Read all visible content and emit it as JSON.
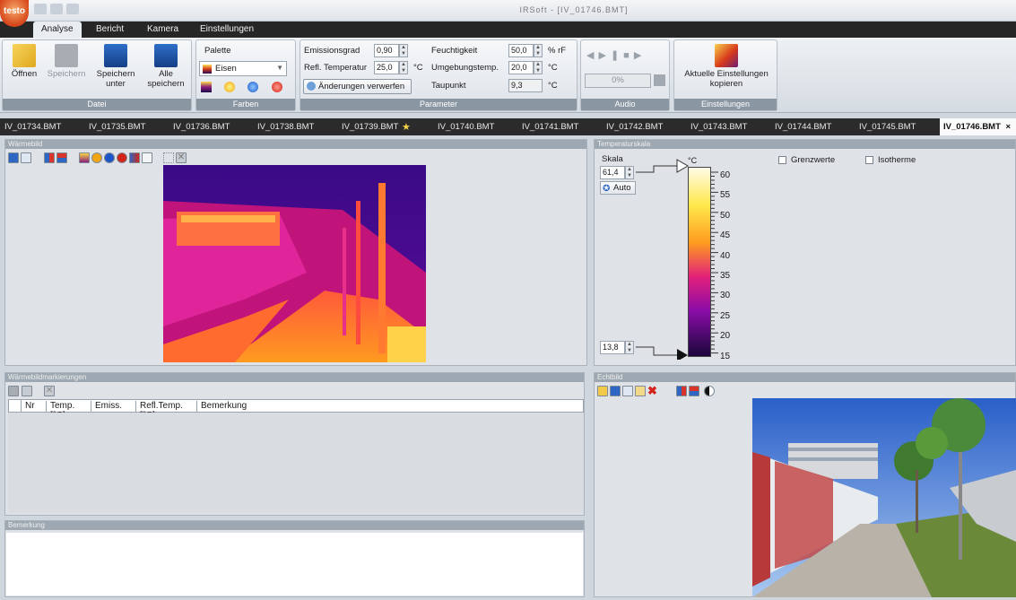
{
  "app": {
    "logo": "testo",
    "window_title": "IRSoft - [IV_01746.BMT]"
  },
  "menu_tabs": [
    "Analyse",
    "Bericht",
    "Kamera",
    "Einstellungen"
  ],
  "ribbon": {
    "datei": {
      "caption": "Datei",
      "open": "Öffnen",
      "save": "Speichern",
      "save_as_1": "Speichern",
      "save_as_2": "unter",
      "save_all_1": "Alle",
      "save_all_2": "speichern"
    },
    "farben": {
      "caption": "Farben",
      "palette_label": "Palette",
      "palette_value": "Eisen"
    },
    "parameter": {
      "caption": "Parameter",
      "emission_label": "Emissionsgrad",
      "emission_value": "0,90",
      "refl_label": "Refl. Temperatur",
      "refl_value": "25,0",
      "refl_unit": "°C",
      "discard_button": "Änderungen verwerfen",
      "humidity_label": "Feuchtigkeit",
      "humidity_value": "50,0",
      "humidity_unit": "% rF",
      "ambient_label": "Umgebungstemp.",
      "ambient_value": "20,0",
      "ambient_unit": "°C",
      "dewpoint_label": "Taupunkt",
      "dewpoint_value": "9,3",
      "dewpoint_unit": "°C"
    },
    "audio": {
      "caption": "Audio",
      "progress": "0%",
      "progress_fraction": 0
    },
    "einstellungen": {
      "caption": "Einstellungen",
      "copy_1": "Aktuelle Einstellungen",
      "copy_2": "kopieren"
    }
  },
  "file_tabs": [
    "IV_01734.BMT",
    "IV_01735.BMT",
    "IV_01736.BMT",
    "IV_01738.BMT",
    "IV_01739.BMT",
    "IV_01740.BMT",
    "IV_01741.BMT",
    "IV_01742.BMT",
    "IV_01743.BMT",
    "IV_01744.BMT",
    "IV_01745.BMT",
    "IV_01746.BMT"
  ],
  "file_tab_close": "×",
  "panels": {
    "waermebild": "Wärmebild",
    "temperaturskala": "Temperaturskala",
    "markierungen": "Wärmebildmarkierungen",
    "echtbild": "Echtbild",
    "bemerkung": "Bemerkung"
  },
  "scale": {
    "skala_label": "Skala",
    "max_value": "61,4",
    "min_value": "13,8",
    "auto_label": "Auto",
    "unit": "°C",
    "ticks": [
      "60",
      "55",
      "50",
      "45",
      "40",
      "35",
      "30",
      "25",
      "20",
      "15"
    ],
    "grenzwerte": "Grenzwerte",
    "isotherme": "Isotherme"
  },
  "table_columns": [
    "Nr",
    "Temp. [°C]",
    "Emiss.",
    "Refl.Temp. [°C]",
    "Bemerkung"
  ],
  "colors": {
    "menu_bg": "#262626",
    "accent": "#d6461a",
    "panel_header": "#9ea8b2"
  }
}
